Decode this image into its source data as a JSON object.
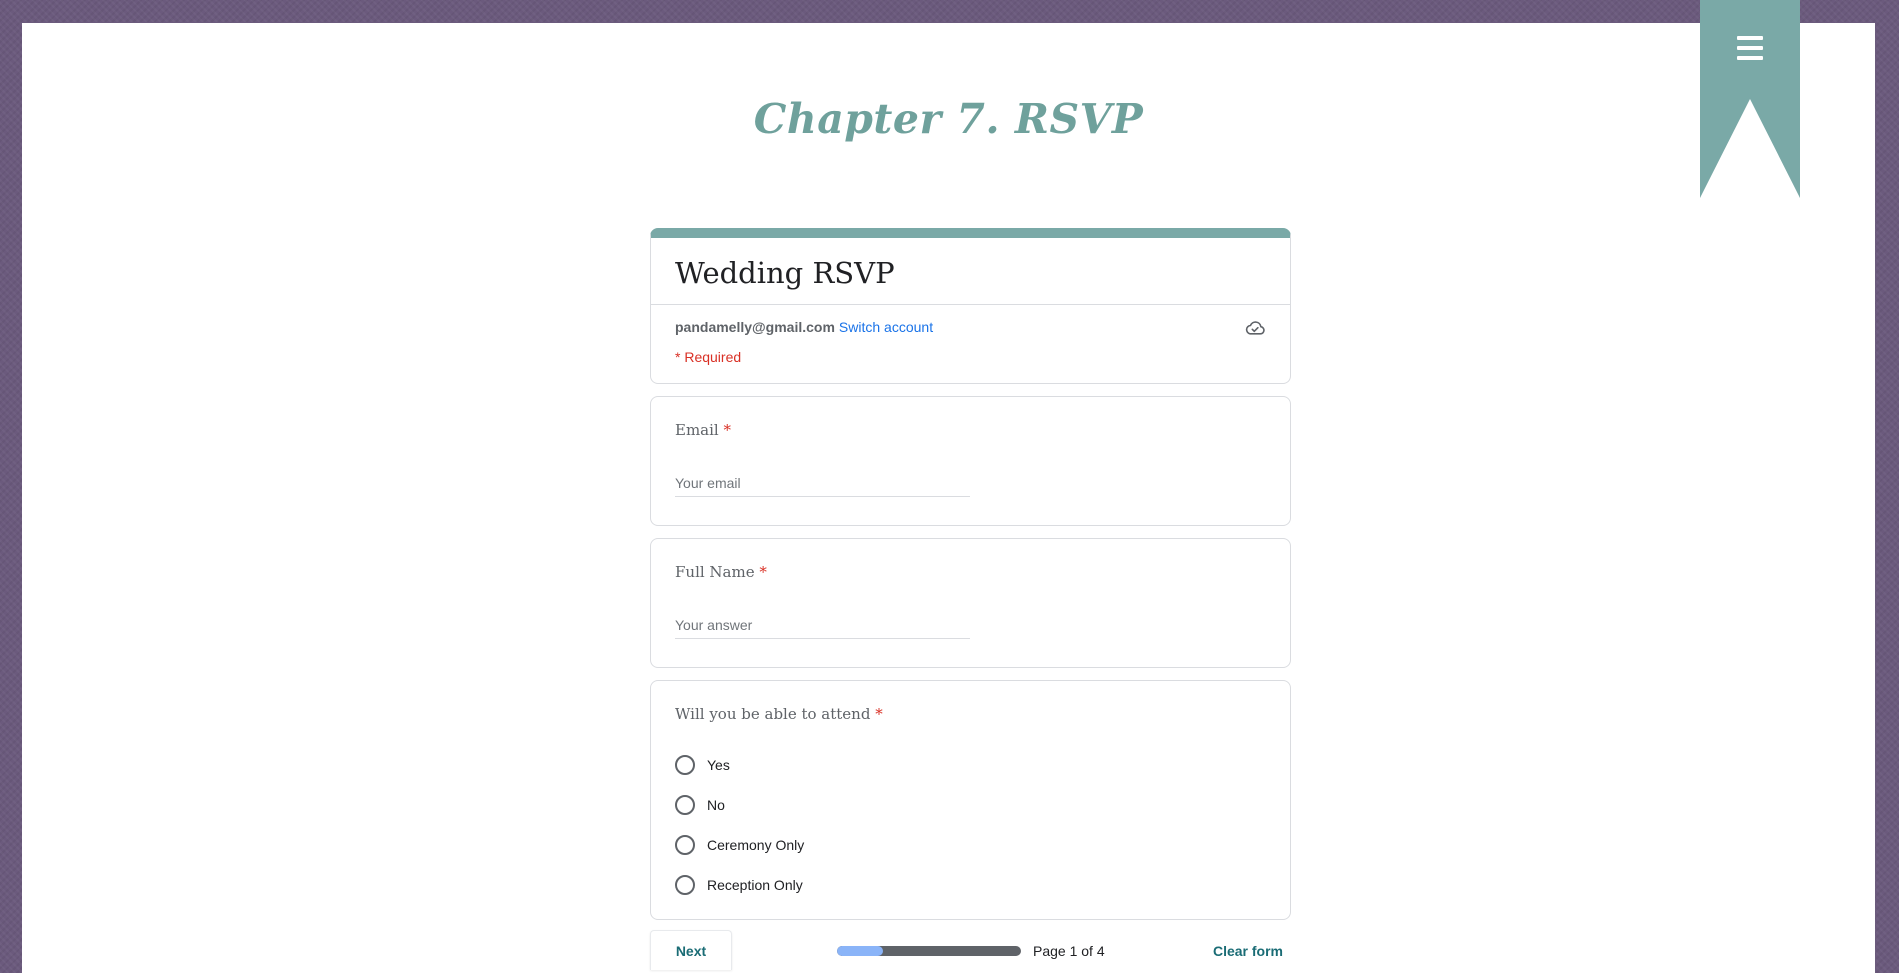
{
  "site": {
    "title": "Chapter 7. RSVP",
    "menu_icon": "hamburger-menu-icon",
    "ribbon_color": "#7aa9a7",
    "background_color": "#6b5a7d",
    "title_color": "#6fa19c"
  },
  "form": {
    "title": "Wedding RSVP",
    "account_email": "pandamelly@gmail.com",
    "switch_account_label": "Switch account",
    "cloud_icon": "cloud-save-icon",
    "required_note": "* Required",
    "accent_color": "#7aa9a7"
  },
  "questions": {
    "email": {
      "label": "Email",
      "required_mark": "*",
      "placeholder": "Your email"
    },
    "full_name": {
      "label": "Full Name",
      "required_mark": "*",
      "placeholder": "Your answer"
    },
    "attend": {
      "label": "Will you be able to attend",
      "required_mark": "*",
      "options": [
        "Yes",
        "No",
        "Ceremony Only",
        "Reception Only"
      ]
    }
  },
  "footer": {
    "next_label": "Next",
    "page_label": "Page 1 of 4",
    "progress_fraction": 0.25,
    "clear_label": "Clear form"
  }
}
